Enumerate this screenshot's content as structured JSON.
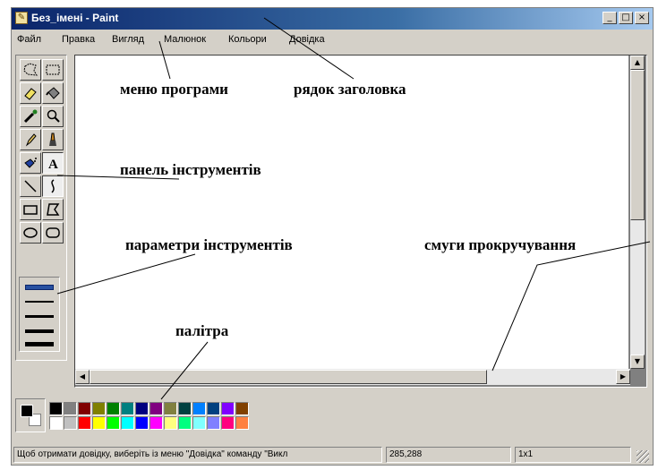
{
  "window": {
    "title": "Без_імені - Paint",
    "buttons": {
      "minimize": "_",
      "maximize": "□",
      "close": "×"
    }
  },
  "menu": [
    "Файл",
    "Правка",
    "Вигляд",
    "Малюнок",
    "Кольори",
    "Довідка"
  ],
  "tools": [
    "free-select",
    "rect-select",
    "eraser",
    "fill",
    "color-picker",
    "magnifier",
    "pencil",
    "brush",
    "airbrush",
    "text",
    "line",
    "curve",
    "rectangle",
    "polygon",
    "ellipse",
    "rounded-rectangle"
  ],
  "palette": {
    "foreground": "#000000",
    "background": "#ffffff",
    "row1": [
      "#000000",
      "#808080",
      "#800000",
      "#808000",
      "#008000",
      "#008080",
      "#000080",
      "#800080",
      "#808040",
      "#004040",
      "#0080ff",
      "#004080",
      "#8000ff",
      "#804000"
    ],
    "row2": [
      "#ffffff",
      "#c0c0c0",
      "#ff0000",
      "#ffff00",
      "#00ff00",
      "#00ffff",
      "#0000ff",
      "#ff00ff",
      "#ffff80",
      "#00ff80",
      "#80ffff",
      "#8080ff",
      "#ff0080",
      "#ff8040"
    ]
  },
  "status": {
    "hint": "Щоб отримати довідку, виберіть із меню \"Довідка\" команду \"Викл",
    "coords": "285,288",
    "size": "1x1"
  },
  "annotations": {
    "menu": "меню програми",
    "title": "рядок заголовка",
    "toolbar": "панель інструментів",
    "params": "параметри інструментів",
    "scrollbars": "смуги прокручування",
    "palette": "палітра"
  }
}
